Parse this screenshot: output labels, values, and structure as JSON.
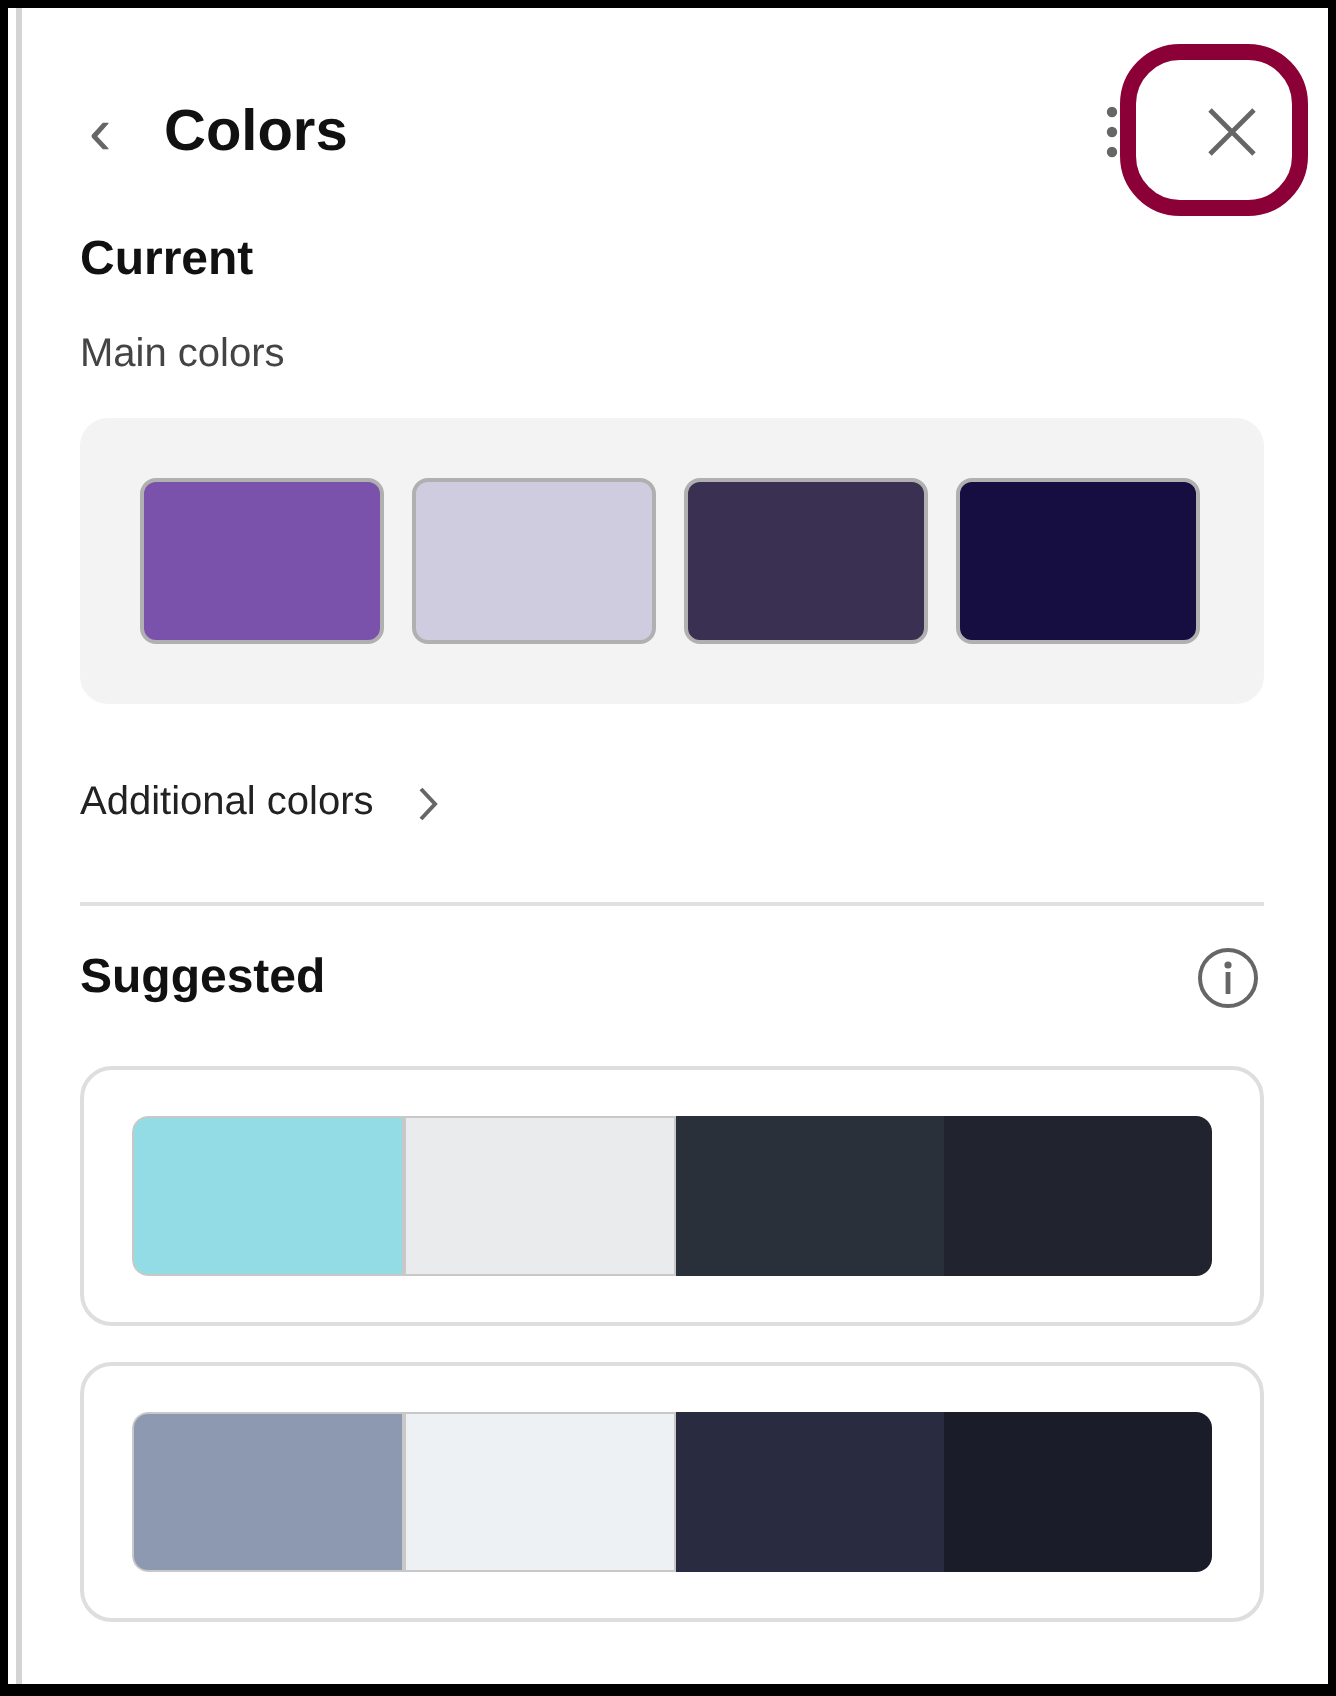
{
  "header": {
    "back_icon": "‹",
    "title": "Colors",
    "close_button": {
      "highlighted": true
    }
  },
  "current": {
    "title": "Current",
    "subtitle": "Main colors",
    "swatches": [
      {
        "color": "#7b52ab"
      },
      {
        "color": "#d0cce0"
      },
      {
        "color": "#3a3152"
      },
      {
        "color": "#160d40"
      }
    ],
    "additional_link": "Additional colors"
  },
  "suggested": {
    "title": "Suggested",
    "palettes": [
      {
        "colors": [
          {
            "color": "#93dce5"
          },
          {
            "color": "#eaebed"
          },
          {
            "color": "#29303a"
          },
          {
            "color": "#21232e"
          }
        ]
      },
      {
        "colors": [
          {
            "color": "#8d99b0"
          },
          {
            "color": "#edf1f4"
          },
          {
            "color": "#292b41"
          },
          {
            "color": "#1b1c29"
          }
        ]
      }
    ]
  }
}
